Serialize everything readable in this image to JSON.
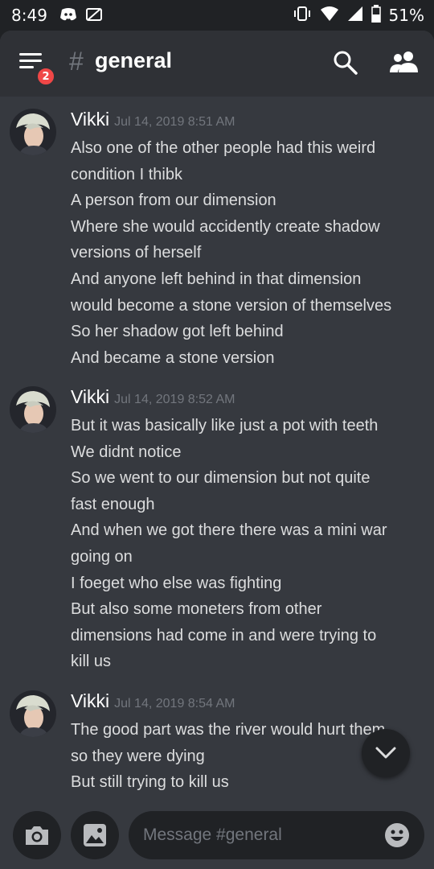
{
  "status_bar": {
    "time": "8:49",
    "battery": "51%",
    "left_icons": [
      "discord-icon",
      "no-sim-icon"
    ],
    "right_icons": [
      "vibrate-icon",
      "wifi-icon",
      "signal-icon",
      "battery-icon"
    ]
  },
  "header": {
    "unread_badge": "2",
    "channel_hash": "#",
    "channel_name": "general"
  },
  "messages": [
    {
      "author": "Vikki",
      "timestamp": "Jul 14, 2019 8:51 AM",
      "lines": [
        "Also one of the other people had this weird",
        "condition I thibk",
        "A person from our dimension",
        "Where she would accidently create shadow",
        "versions of herself",
        "And anyone left behind in that dimension",
        "would become a stone version of themselves",
        "So her shadow got left behind",
        "And became a stone version"
      ]
    },
    {
      "author": "Vikki",
      "timestamp": "Jul 14, 2019 8:52 AM",
      "lines": [
        "But it was basically like just a pot with teeth",
        "We didnt notice",
        "So we went to our dimension but not quite",
        "fast enough",
        "And when we got there there was a mini war",
        "going on",
        "I foeget who else was fighting",
        "But also some moneters from other",
        "dimensions had come in and were trying to",
        "kill us"
      ]
    },
    {
      "author": "Vikki",
      "timestamp": "Jul 14, 2019 8:54 AM",
      "lines": [
        "The good part was the river would hurt them",
        "so they were dying",
        "But still trying to kill us"
      ]
    }
  ],
  "composer": {
    "placeholder": "Message #general"
  },
  "colors": {
    "background": "#36393f",
    "header": "#2f3136",
    "dark": "#202225",
    "badge": "#f04747",
    "muted": "#72767d",
    "text": "#dcddde"
  }
}
